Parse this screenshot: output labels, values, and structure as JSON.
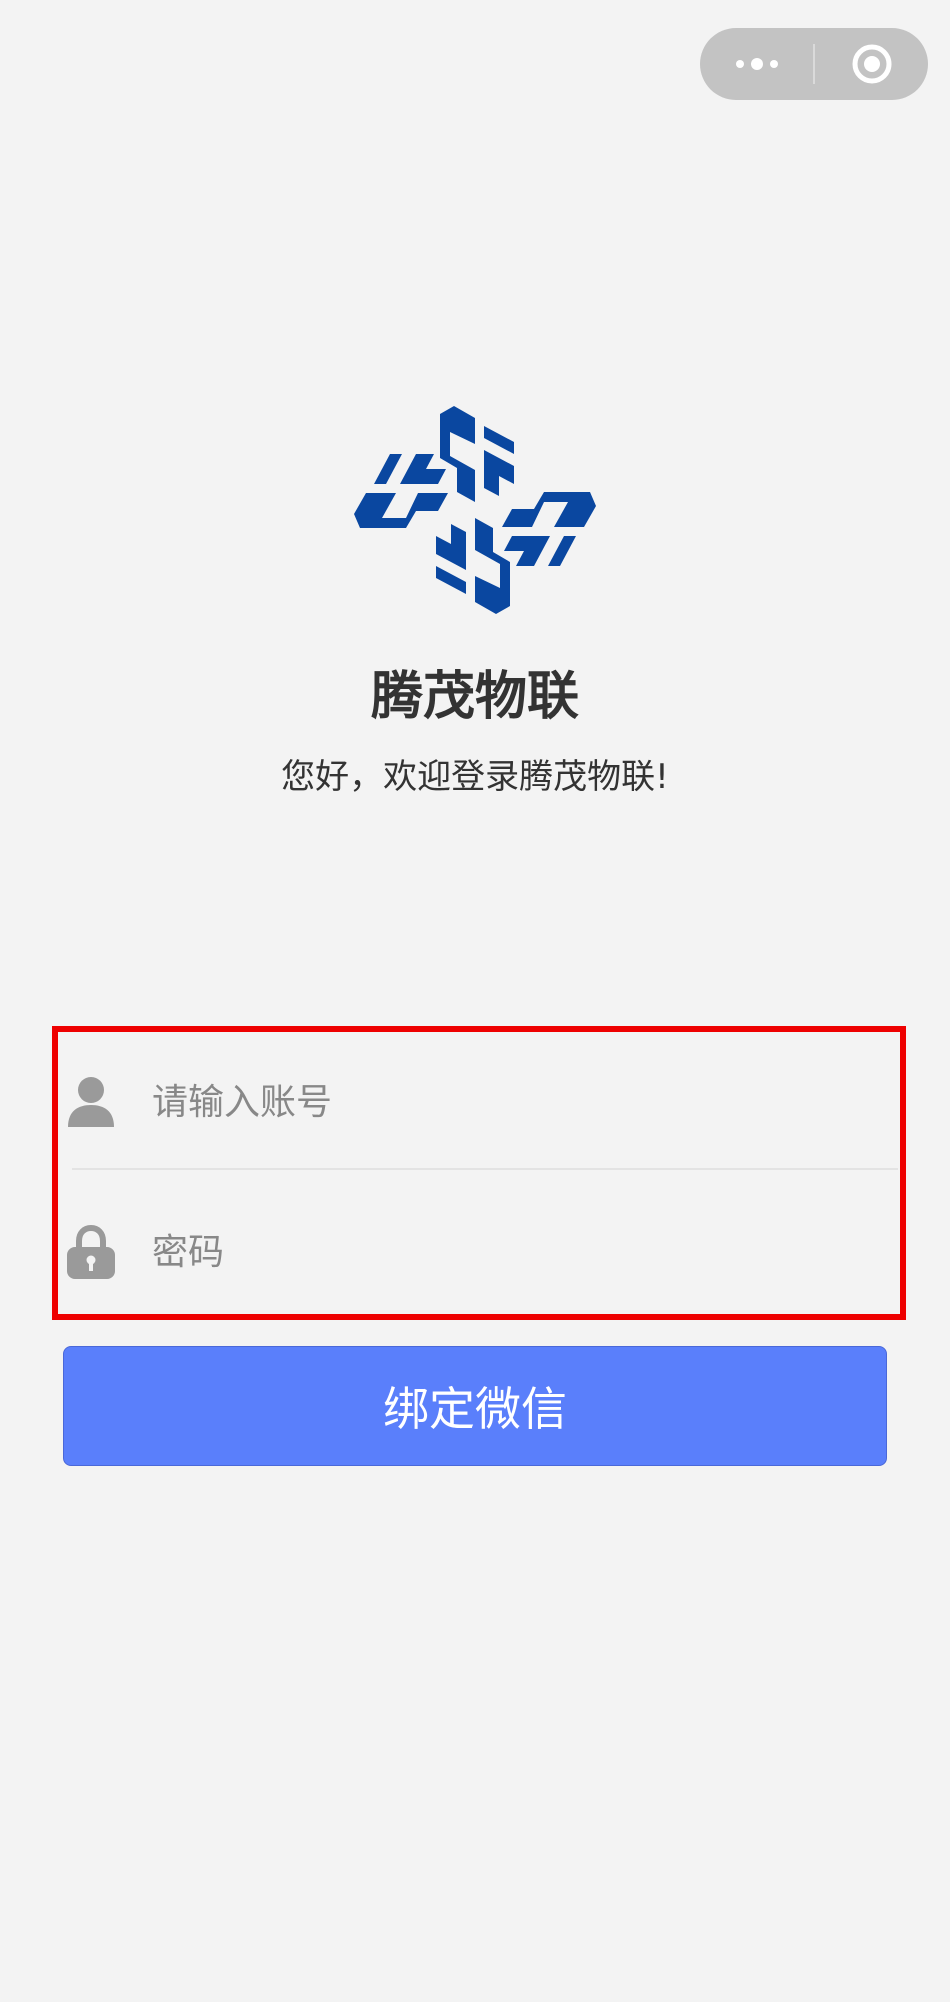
{
  "header": {
    "menu_icon": "more-dots-icon",
    "close_icon": "target-circle-icon"
  },
  "brand": {
    "logo_icon": "tengmao-logo",
    "logo_color": "#0a47a0",
    "title": "腾茂物联",
    "welcome": "您好，欢迎登录腾茂物联!"
  },
  "form": {
    "account": {
      "icon": "user-icon",
      "placeholder": "请输入账号",
      "value": ""
    },
    "password": {
      "icon": "lock-icon",
      "placeholder": "密码",
      "value": ""
    },
    "highlight_color": "#ee0000"
  },
  "actions": {
    "bind_label": "绑定微信",
    "bind_color": "#5a7ffb"
  }
}
